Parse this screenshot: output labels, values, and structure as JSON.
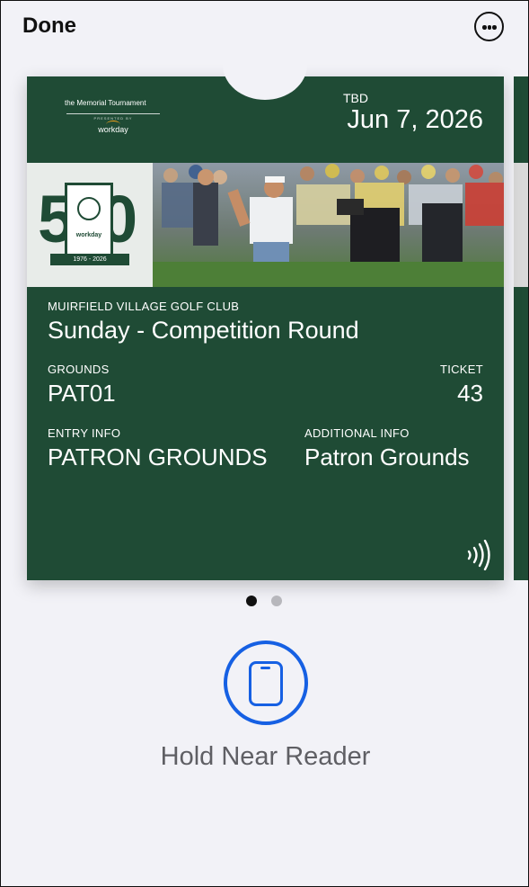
{
  "topbar": {
    "done_label": "Done",
    "more_icon": "ellipsis-circle-icon"
  },
  "pass": {
    "logo": {
      "line1": "the Memorial Tournament",
      "presented": "PRESENTED BY",
      "sponsor": "workday"
    },
    "date_label": "TBD",
    "date_value": "Jun 7, 2026",
    "badge": {
      "digits": "50",
      "sponsor": "workday",
      "years": "1976 - 2026"
    },
    "venue": "MUIRFIELD VILLAGE GOLF CLUB",
    "event": "Sunday - Competition Round",
    "fields": {
      "grounds_label": "GROUNDS",
      "grounds_value": "PAT01",
      "ticket_label": "TICKET",
      "ticket_value": "43",
      "entry_label": "ENTRY INFO",
      "entry_value": "PATRON GROUNDS",
      "additional_label": "ADDITIONAL INFO",
      "additional_value": "Patron Grounds"
    },
    "nfc_icon": "contactless-icon"
  },
  "pagination": {
    "count": 2,
    "active": 1
  },
  "reader": {
    "icon": "phone-icon",
    "label": "Hold Near Reader"
  },
  "colors": {
    "pass_green": "#1f4b35",
    "accent_blue": "#1660e3",
    "background": "#f2f2f7"
  }
}
